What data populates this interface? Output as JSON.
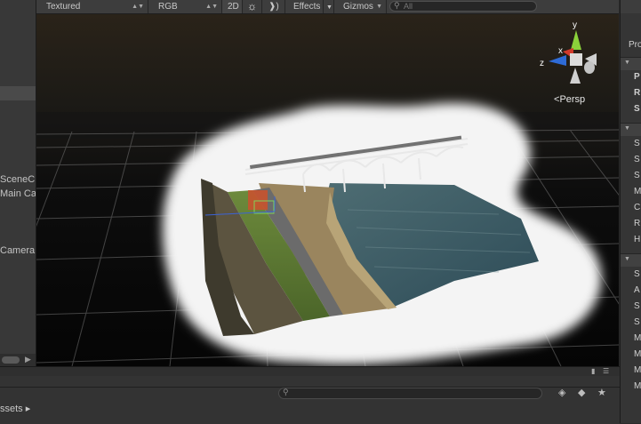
{
  "toolbar": {
    "render_mode": "Textured",
    "color_mode": "RGB",
    "twod_label": "2D",
    "sun_icon": "sun-icon",
    "audio_icon": "audio-icon",
    "effects_label": "Effects",
    "gizmos_label": "Gizmos",
    "search_placeholder": "All",
    "search_icon_glyph": "⚲"
  },
  "hierarchy": {
    "items": [
      "SceneC",
      "Main Ca",
      "Camera"
    ]
  },
  "scene": {
    "projection_label": "Persp",
    "gizmo_labels": {
      "y": "y",
      "x": "x",
      "z": "z"
    }
  },
  "inspector": {
    "rows": [
      "Pro",
      "P",
      "R",
      "S",
      "S",
      "S",
      "S",
      "M",
      "C",
      "R",
      "H",
      "S",
      "A",
      "S",
      "S",
      "M",
      "M",
      "M",
      "M"
    ]
  },
  "bottom": {
    "assets_label": "ssets ▸",
    "search_icon_glyph": "⚲"
  },
  "colors": {
    "panel": "#383838",
    "toolbar": "#3d3d3d",
    "gizmo_y": "#8bd23a",
    "gizmo_x": "#d23a2c",
    "gizmo_z": "#2e6bd6",
    "water": "#3e5e6a"
  }
}
